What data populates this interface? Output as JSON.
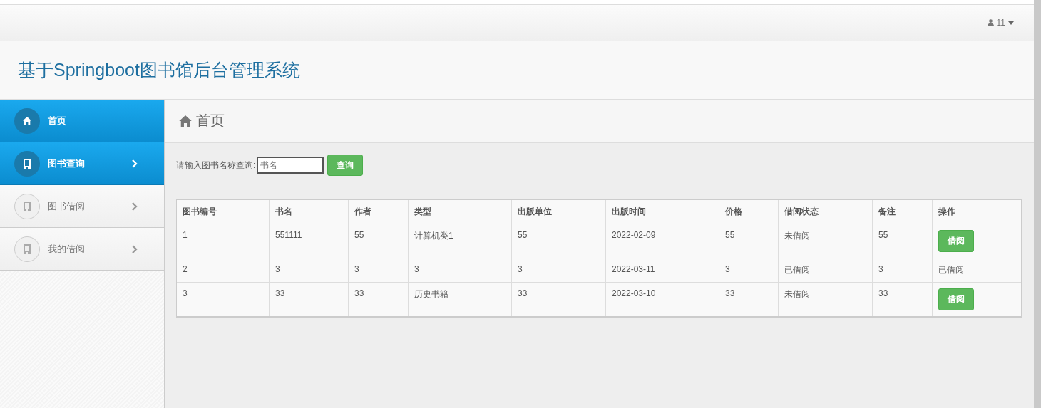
{
  "user_menu": {
    "label": "11"
  },
  "header": {
    "title": "基于Springboot图书馆后台管理系统"
  },
  "sidebar": {
    "items": [
      {
        "label": "首页",
        "kind": "home",
        "selected": true,
        "chevron": false
      },
      {
        "label": "图书查询",
        "kind": "book",
        "selected": true,
        "chevron": true
      },
      {
        "label": "图书借阅",
        "kind": "book",
        "selected": false,
        "chevron": true
      },
      {
        "label": "我的借阅",
        "kind": "book",
        "selected": false,
        "chevron": true
      }
    ]
  },
  "page_title": "首页",
  "search": {
    "label": "请输入图书名称查询:",
    "placeholder": "书名",
    "button": "查询"
  },
  "table": {
    "columns": [
      "图书编号",
      "书名",
      "作者",
      "类型",
      "出版单位",
      "出版时间",
      "价格",
      "借阅状态",
      "备注",
      "操作"
    ],
    "rows": [
      {
        "cells": [
          "1",
          "551111",
          "55",
          "计算机类1",
          "55",
          "2022-02-09",
          "55",
          "未借阅",
          "55"
        ],
        "action": {
          "kind": "button",
          "label": "借阅"
        }
      },
      {
        "cells": [
          "2",
          "3",
          "3",
          "3",
          "3",
          "2022-03-11",
          "3",
          "已借阅",
          "3"
        ],
        "action": {
          "kind": "text",
          "label": "已借阅"
        }
      },
      {
        "cells": [
          "3",
          "33",
          "33",
          "历史书籍",
          "33",
          "2022-03-10",
          "33",
          "未借阅",
          "33"
        ],
        "action": {
          "kind": "button",
          "label": "借阅"
        }
      }
    ]
  }
}
